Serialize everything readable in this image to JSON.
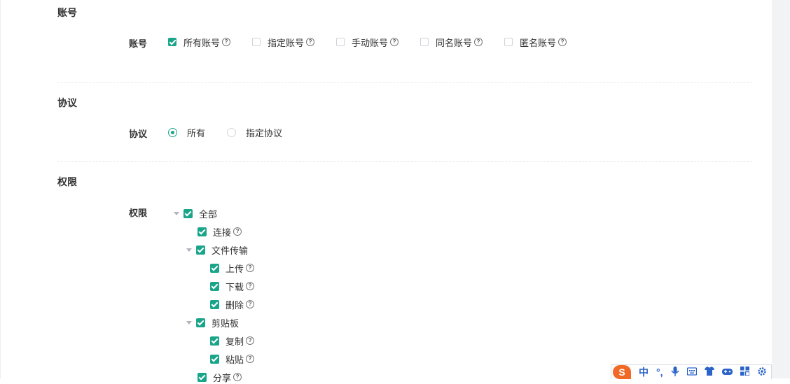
{
  "sections": {
    "account": {
      "title": "账号",
      "field_label": "账号",
      "options": [
        {
          "label": "所有账号",
          "checked": true
        },
        {
          "label": "指定账号",
          "checked": false
        },
        {
          "label": "手动账号",
          "checked": false
        },
        {
          "label": "同名账号",
          "checked": false
        },
        {
          "label": "匿名账号",
          "checked": false
        }
      ]
    },
    "protocol": {
      "title": "协议",
      "field_label": "协议",
      "options": [
        {
          "label": "所有",
          "selected": true
        },
        {
          "label": "指定协议",
          "selected": false
        }
      ]
    },
    "permission": {
      "title": "权限",
      "field_label": "权限",
      "tree": [
        {
          "label": "全部",
          "checked": true,
          "expandable": true,
          "help": false,
          "level": 0
        },
        {
          "label": "连接",
          "checked": true,
          "expandable": false,
          "help": true,
          "level": 1
        },
        {
          "label": "文件传输",
          "checked": true,
          "expandable": true,
          "help": false,
          "level": 1
        },
        {
          "label": "上传",
          "checked": true,
          "expandable": false,
          "help": true,
          "level": 2
        },
        {
          "label": "下载",
          "checked": true,
          "expandable": false,
          "help": true,
          "level": 2
        },
        {
          "label": "删除",
          "checked": true,
          "expandable": false,
          "help": true,
          "level": 2
        },
        {
          "label": "剪贴板",
          "checked": true,
          "expandable": true,
          "help": false,
          "level": 1
        },
        {
          "label": "复制",
          "checked": true,
          "expandable": false,
          "help": true,
          "level": 2
        },
        {
          "label": "粘贴",
          "checked": true,
          "expandable": false,
          "help": true,
          "level": 2
        },
        {
          "label": "分享",
          "checked": true,
          "expandable": false,
          "help": true,
          "level": 1
        }
      ]
    }
  },
  "help_glyph": "?",
  "ime_toolbar": {
    "logo": "S",
    "items": [
      "中",
      "°,",
      "mic-icon",
      "keyboard-icon",
      "shirt-icon",
      "gamepad-icon",
      "grid-icon",
      "settings-icon"
    ],
    "mode_label": "中",
    "punct_label": "°,"
  },
  "colors": {
    "accent": "#1aa58a",
    "ime_brand": "#f06a25",
    "ime_icon": "#2b63c9"
  }
}
